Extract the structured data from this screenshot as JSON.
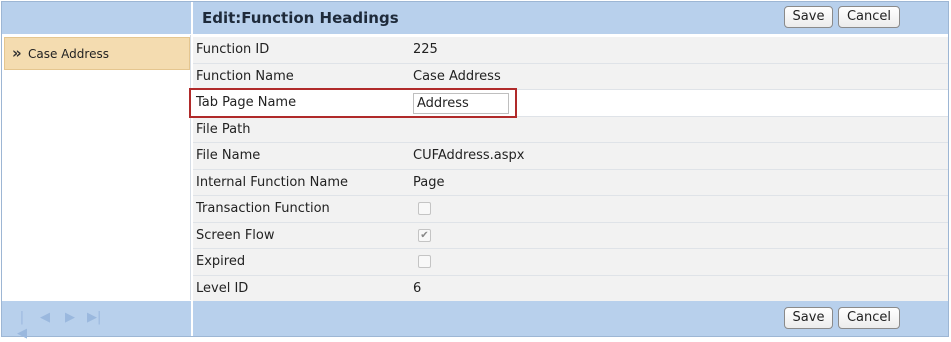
{
  "header": {
    "title": "Edit:Function Headings",
    "save_label": "Save",
    "cancel_label": "Cancel"
  },
  "sidebar": {
    "items": [
      {
        "icon": "double-chevron-right-icon",
        "label": "Case Address"
      }
    ]
  },
  "form": {
    "function_id": {
      "label": "Function ID",
      "value": "225"
    },
    "function_name": {
      "label": "Function Name",
      "value": "Case Address"
    },
    "tab_page_name": {
      "label": "Tab Page Name",
      "value": "Address"
    },
    "file_path": {
      "label": "File Path",
      "value": ""
    },
    "file_name": {
      "label": "File Name",
      "value": "CUFAddress.aspx"
    },
    "internal_function_name": {
      "label": "Internal Function Name",
      "value": "Page"
    },
    "transaction_function": {
      "label": "Transaction Function",
      "checked": false
    },
    "screen_flow": {
      "label": "Screen Flow",
      "checked": true
    },
    "expired": {
      "label": "Expired",
      "checked": false
    },
    "level_id": {
      "label": "Level ID",
      "value": "6"
    }
  },
  "footer": {
    "save_label": "Save",
    "cancel_label": "Cancel",
    "pager_icons": [
      "first-page-icon",
      "prev-page-icon",
      "next-page-icon",
      "last-page-icon"
    ]
  },
  "colors": {
    "header_bg": "#b8d0ec",
    "sidebar_selected_bg": "#f4dcb0",
    "highlight_border": "#b02a2a"
  }
}
